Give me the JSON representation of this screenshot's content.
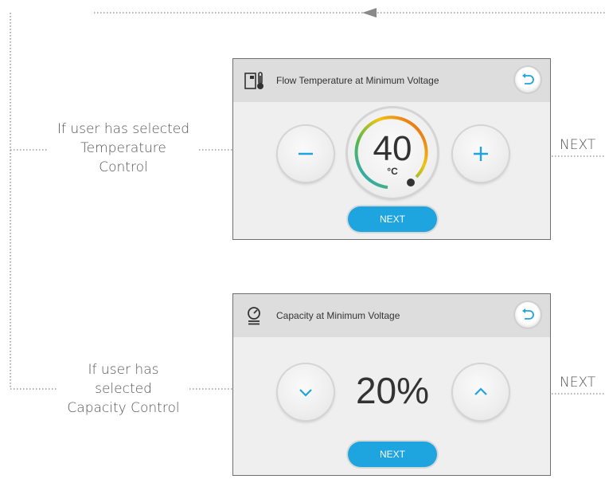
{
  "labels": {
    "temperature_condition": [
      "If user has selected",
      "Temperature",
      "Control"
    ],
    "capacity_condition": [
      "If user has",
      "selected",
      "Capacity Control"
    ],
    "next_top": "NEXT",
    "next_bottom": "NEXT"
  },
  "screen_temperature": {
    "header_icon": "thermostat-unit-icon",
    "title": "Flow Temperature at Minimum Voltage",
    "back_icon": "back-arrow-icon",
    "decrease_icon": "minus-icon",
    "increase_icon": "plus-icon",
    "value": "40",
    "unit": "°C",
    "next_label": "NEXT",
    "colors": {
      "gauge_cool": "#1ea4df",
      "gauge_mid": "#f1c40f",
      "gauge_warm": "#e74c1c",
      "button": "#1ea4df"
    }
  },
  "screen_capacity": {
    "header_icon": "capacity-gauge-icon",
    "title": "Capacity at Minimum Voltage",
    "back_icon": "back-arrow-icon",
    "decrease_icon": "chevron-down-icon",
    "increase_icon": "chevron-up-icon",
    "value": "20%",
    "next_label": "NEXT",
    "colors": {
      "button": "#1ea4df"
    }
  }
}
